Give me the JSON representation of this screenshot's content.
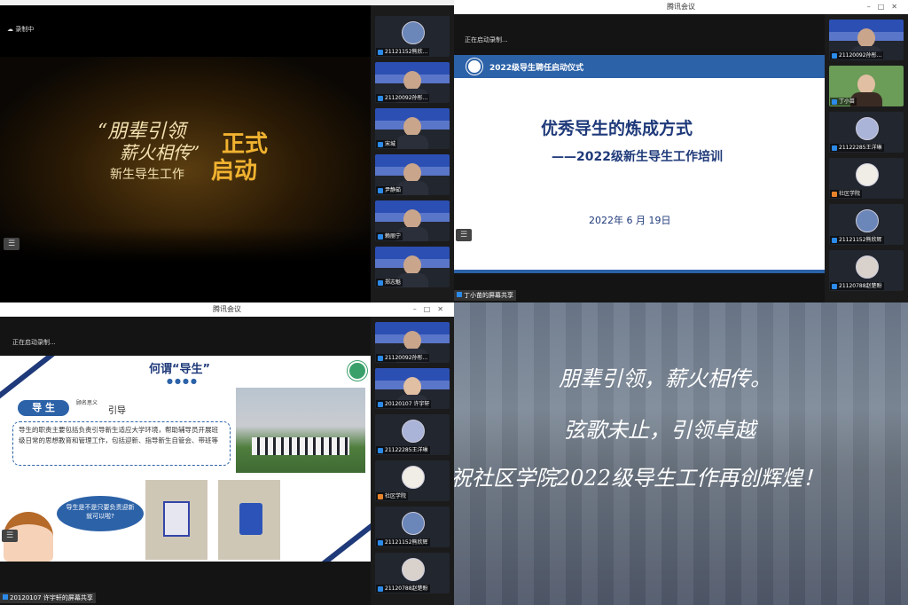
{
  "q1": {
    "status": "录制中",
    "banner_line1": "“朋辈引领",
    "banner_line2": "薪火相传”",
    "banner_line3": "新生导生工作",
    "banner_right1": "正式",
    "banner_right2": "启动",
    "participants": [
      "21121152熊欣...",
      "21120092孙彤...",
      "宋城",
      "尹静茹",
      "赖丽宁",
      "郑志魁"
    ]
  },
  "q2": {
    "window_title": "腾讯会议",
    "status": "正在启动录制...",
    "slide_header": "2022级导生聘任启动仪式",
    "slide_title": "优秀导生的炼成方式",
    "slide_subtitle": "——2022级新生导生工作培训",
    "slide_date": "2022年 6 月 19日",
    "share_label": "丁小苗的屏幕共享",
    "participants": [
      "21120092孙彤...",
      "丁小苗",
      "21122285王洋琳",
      "社区学院",
      "21121152熊欣辉",
      "21120788赵楚盼"
    ]
  },
  "q3": {
    "window_title": "腾讯会议",
    "status": "正在启动录制...",
    "slide_title": "何谓“导生”",
    "tag": "导 生",
    "tag_small": "顾名思义",
    "tag_word": "引导",
    "desc": "导生的职责主要包括负责引导新生适应大学环境，帮助辅导员开展班级日常的思想教育和管理工作，包括迎新、指导新生自管会、带班等",
    "bubble": "导生是不是只要负责迎新就可以啦?",
    "share_label": "20120107 许宇轩的屏幕共享",
    "participants": [
      "21120092孙彤...",
      "20120107 许宇轩",
      "21122285王洋琳",
      "社区学院",
      "21121152熊欣辉",
      "21120788赵楚盼"
    ]
  },
  "q4": {
    "line1": "朋辈引领，薪火相传。",
    "line2": "弦歌未止，引领卓越",
    "line3": "祝社区学院2022级导生工作再创辉煌！"
  }
}
